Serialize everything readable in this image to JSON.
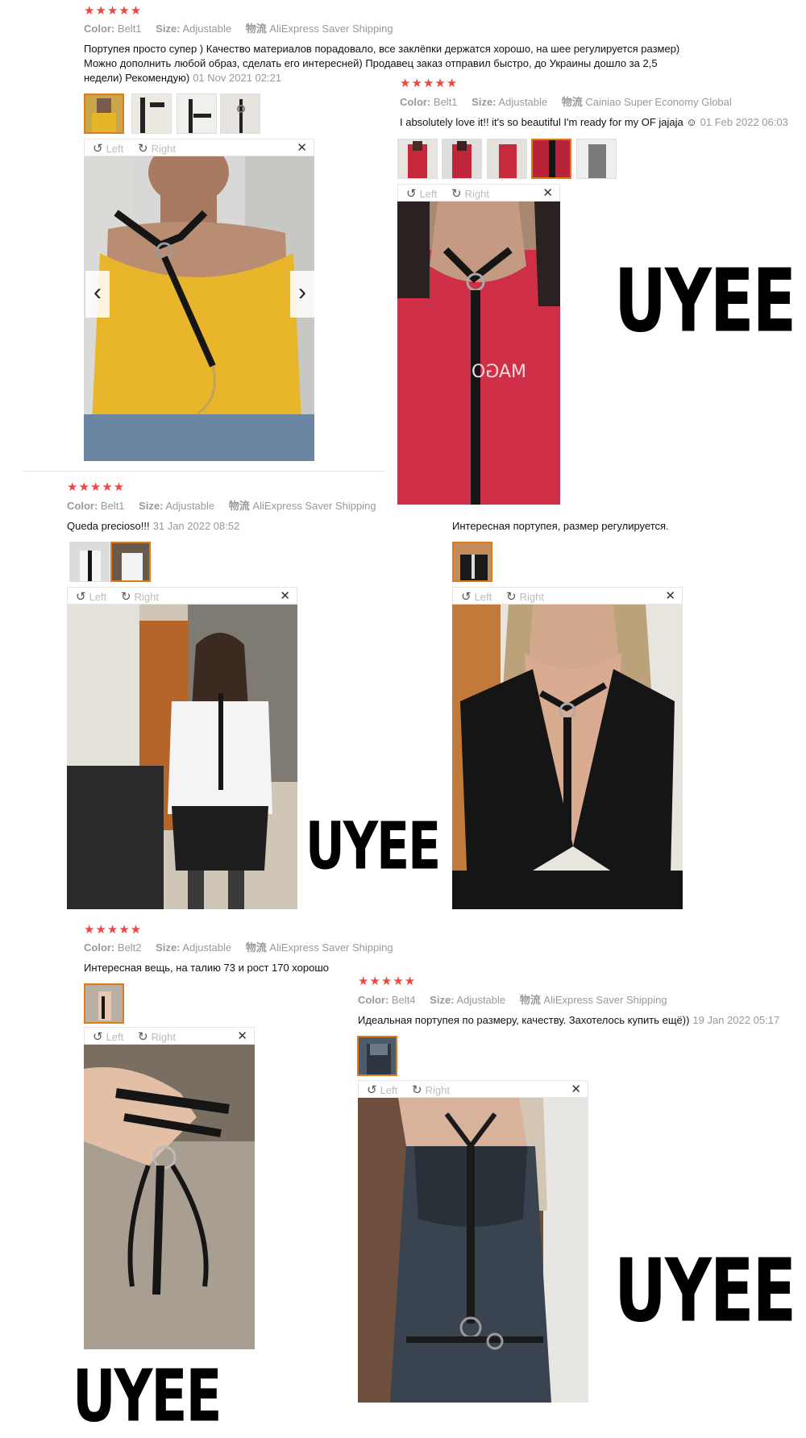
{
  "brand_logo": "UYEE",
  "labels": {
    "color": "Color:",
    "size": "Size:",
    "shipping": "物流",
    "left": "Left",
    "right": "Right"
  },
  "rating": "★★★★★",
  "reviews": [
    {
      "color": "Belt1",
      "size": "Adjustable",
      "shipping": "AliExpress Saver Shipping",
      "text": "Портупея просто супер ) Качество материалов порадовало, все заклёпки держатся хорошо, на шее регулируется размер) Можно дополнить любой образ, сделать его интересней) Продавец заказ отправил быстро, до Украины дошло за 2,5 недели) Рекомендую)",
      "date": "01 Nov 2021 02:21"
    },
    {
      "color": "Belt1",
      "size": "Adjustable",
      "shipping": "Cainiao Super Economy Global",
      "text": "I absolutely love it!! it's so beautiful I'm ready for my OF jajaja ☺",
      "date": "01 Feb 2022 06:03"
    },
    {
      "color": "Belt1",
      "size": "Adjustable",
      "shipping": "AliExpress Saver Shipping",
      "text": "Queda precioso!!!",
      "date": "31 Jan 2022 08:52"
    },
    {
      "text": "Интересная портупея, размер регулируется."
    },
    {
      "color": "Belt2",
      "size": "Adjustable",
      "shipping": "AliExpress Saver Shipping",
      "text": "Интересная вещь, на талию 73 и рост 170 хорошо"
    },
    {
      "color": "Belt4",
      "size": "Adjustable",
      "shipping": "AliExpress Saver Shipping",
      "text": "Идеальная портупея по размеру, качеству. Захотелось купить ещё))",
      "date": "19 Jan 2022 05:17"
    }
  ],
  "colors": {
    "star": "#f0463c",
    "selected_border": "#e07a1a",
    "meta_text": "#999999"
  }
}
